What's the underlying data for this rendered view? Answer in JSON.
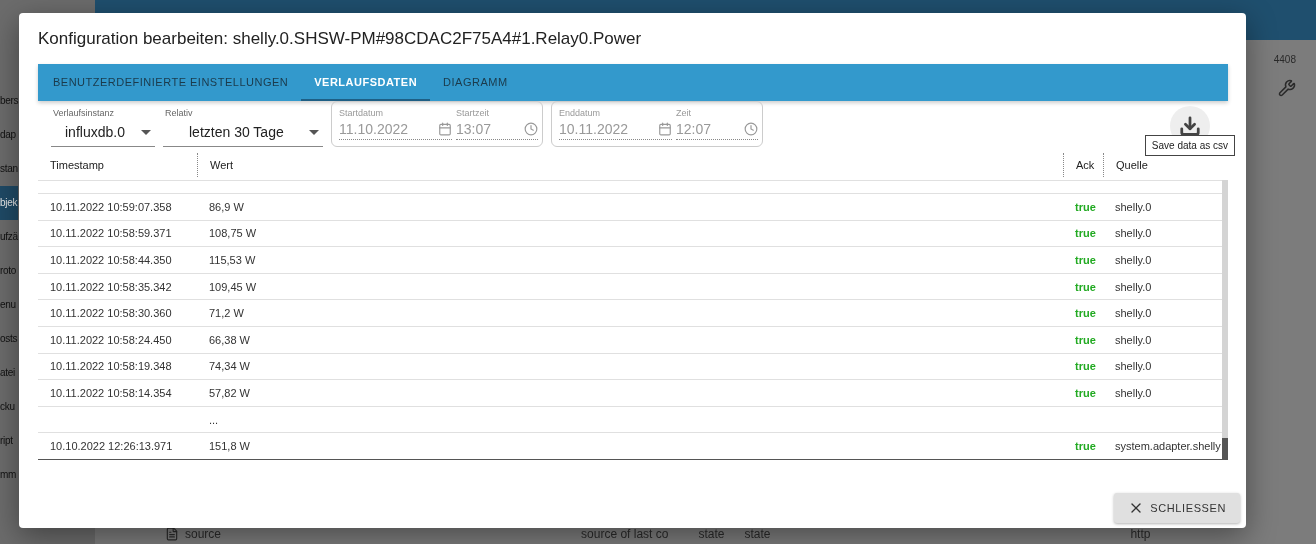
{
  "background": {
    "sidebar_items": [
      {
        "label": "bers",
        "selected": false
      },
      {
        "label": "dap",
        "selected": false
      },
      {
        "label": "stan",
        "selected": false
      },
      {
        "label": "bjek",
        "selected": true
      },
      {
        "label": "ufzä",
        "selected": false
      },
      {
        "label": "roto",
        "selected": false
      },
      {
        "label": "enu",
        "selected": false
      },
      {
        "label": "osts",
        "selected": false
      },
      {
        "label": "atei",
        "selected": false
      },
      {
        "label": "cku",
        "selected": false
      },
      {
        "label": "ript",
        "selected": false
      },
      {
        "label": "mm",
        "selected": false
      }
    ],
    "top_right_text": "4408",
    "bottom_row": {
      "name": "source",
      "description": "source of last co",
      "type": "state",
      "role": "state",
      "value": "http"
    }
  },
  "dialog": {
    "title": "Konfiguration bearbeiten: shelly.0.SHSW-PM#98CDAC2F75A4#1.Relay0.Power",
    "tabs": [
      {
        "label": "BENUTZERDEFINIERTE EINSTELLUNGEN",
        "selected": false
      },
      {
        "label": "VERLAUFSDATEN",
        "selected": true
      },
      {
        "label": "DIAGRAMM",
        "selected": false
      }
    ],
    "filters": {
      "instance": {
        "label": "Verlaufsinstanz",
        "value": "influxdb.0"
      },
      "relative": {
        "label": "Relativ",
        "value": "letzten 30 Tage"
      },
      "ranges": [
        {
          "date_label": "Startdatum",
          "date": "11.10.2022",
          "time_label": "Startzeit",
          "time": "13:07",
          "disabled": true
        },
        {
          "date_label": "Enddatum",
          "date": "10.11.2022",
          "time_label": "Zeit",
          "time": "12:07",
          "disabled": true
        }
      ]
    },
    "download_tooltip": "Save data as csv",
    "table": {
      "columns": [
        "Timestamp",
        "Wert",
        "Ack",
        "Quelle"
      ],
      "rows": [
        {
          "timestamp": "10.11.2022 10:59:07.358",
          "value": "86,9 W",
          "ack": "true",
          "source": "shelly.0"
        },
        {
          "timestamp": "10.11.2022 10:58:59.371",
          "value": "108,75 W",
          "ack": "true",
          "source": "shelly.0"
        },
        {
          "timestamp": "10.11.2022 10:58:44.350",
          "value": "115,53 W",
          "ack": "true",
          "source": "shelly.0"
        },
        {
          "timestamp": "10.11.2022 10:58:35.342",
          "value": "109,45 W",
          "ack": "true",
          "source": "shelly.0"
        },
        {
          "timestamp": "10.11.2022 10:58:30.360",
          "value": "71,2 W",
          "ack": "true",
          "source": "shelly.0"
        },
        {
          "timestamp": "10.11.2022 10:58:24.450",
          "value": "66,38 W",
          "ack": "true",
          "source": "shelly.0"
        },
        {
          "timestamp": "10.11.2022 10:58:19.348",
          "value": "74,34 W",
          "ack": "true",
          "source": "shelly.0"
        },
        {
          "timestamp": "10.11.2022 10:58:14.354",
          "value": "57,82 W",
          "ack": "true",
          "source": "shelly.0"
        },
        {
          "value": "..."
        },
        {
          "timestamp": "10.10.2022 12:26:13.971",
          "value": "151,8 W",
          "ack": "true",
          "source": "system.adapter.shelly"
        }
      ]
    },
    "close_button": "SCHLIESSEN"
  }
}
